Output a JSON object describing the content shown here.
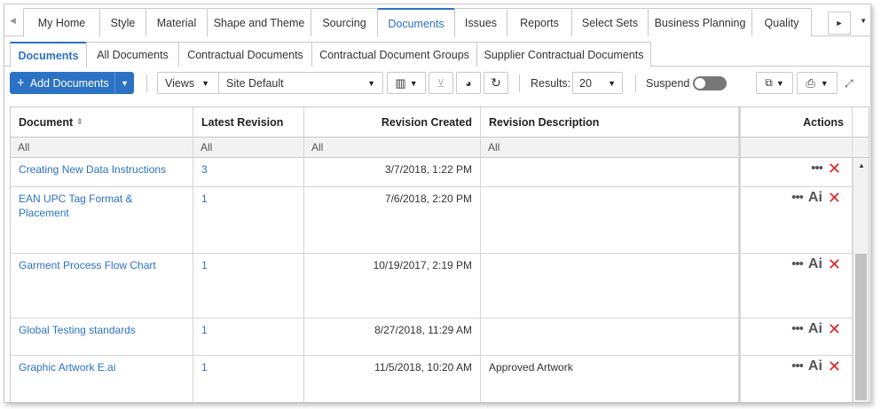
{
  "top_tabs": [
    "My Home",
    "Style",
    "Material",
    "Shape and Theme",
    "Sourcing",
    "Documents",
    "Issues",
    "Reports",
    "Select Sets",
    "Business Planning",
    "Quality"
  ],
  "top_tabs_active": "Documents",
  "sub_tabs": [
    "Documents",
    "All Documents",
    "Contractual Documents",
    "Contractual Document Groups",
    "Supplier Contractual Documents"
  ],
  "toolbar": {
    "add_label": "Add Documents",
    "views_label": "Views",
    "view_select": "Site Default",
    "results_label": "Results:",
    "results_value": "20",
    "suspend_label": "Suspend",
    "suspend_on": false
  },
  "grid": {
    "headers": {
      "document": "Document",
      "latest_revision": "Latest Revision",
      "revision_created": "Revision Created",
      "revision_description": "Revision Description",
      "actions": "Actions"
    },
    "filters": {
      "document": "All",
      "latest_revision": "All",
      "revision_created": "All",
      "revision_description": "All"
    },
    "rows": [
      {
        "document": "Creating New Data Instructions",
        "revision": "3",
        "created": "3/7/2018, 1:22 PM",
        "description": "",
        "ai": false
      },
      {
        "document": "EAN UPC Tag Format & Placement",
        "revision": "1",
        "created": "7/6/2018, 2:20 PM",
        "description": "",
        "ai": true
      },
      {
        "document": "Garment Process Flow Chart",
        "revision": "1",
        "created": "10/19/2017, 2:19 PM",
        "description": "",
        "ai": true
      },
      {
        "document": "Global Testing standards",
        "revision": "1",
        "created": "8/27/2018, 11:29 AM",
        "description": "",
        "ai": true
      },
      {
        "document": "Graphic Artwork E.ai",
        "revision": "1",
        "created": "11/5/2018, 10:20 AM",
        "description": "Approved Artwork",
        "ai": true
      }
    ],
    "action_labels": {
      "more": "•••",
      "ai": "Ai",
      "delete": "✕"
    }
  },
  "colors": {
    "accent": "#2b72c5",
    "delete": "#e02424"
  }
}
